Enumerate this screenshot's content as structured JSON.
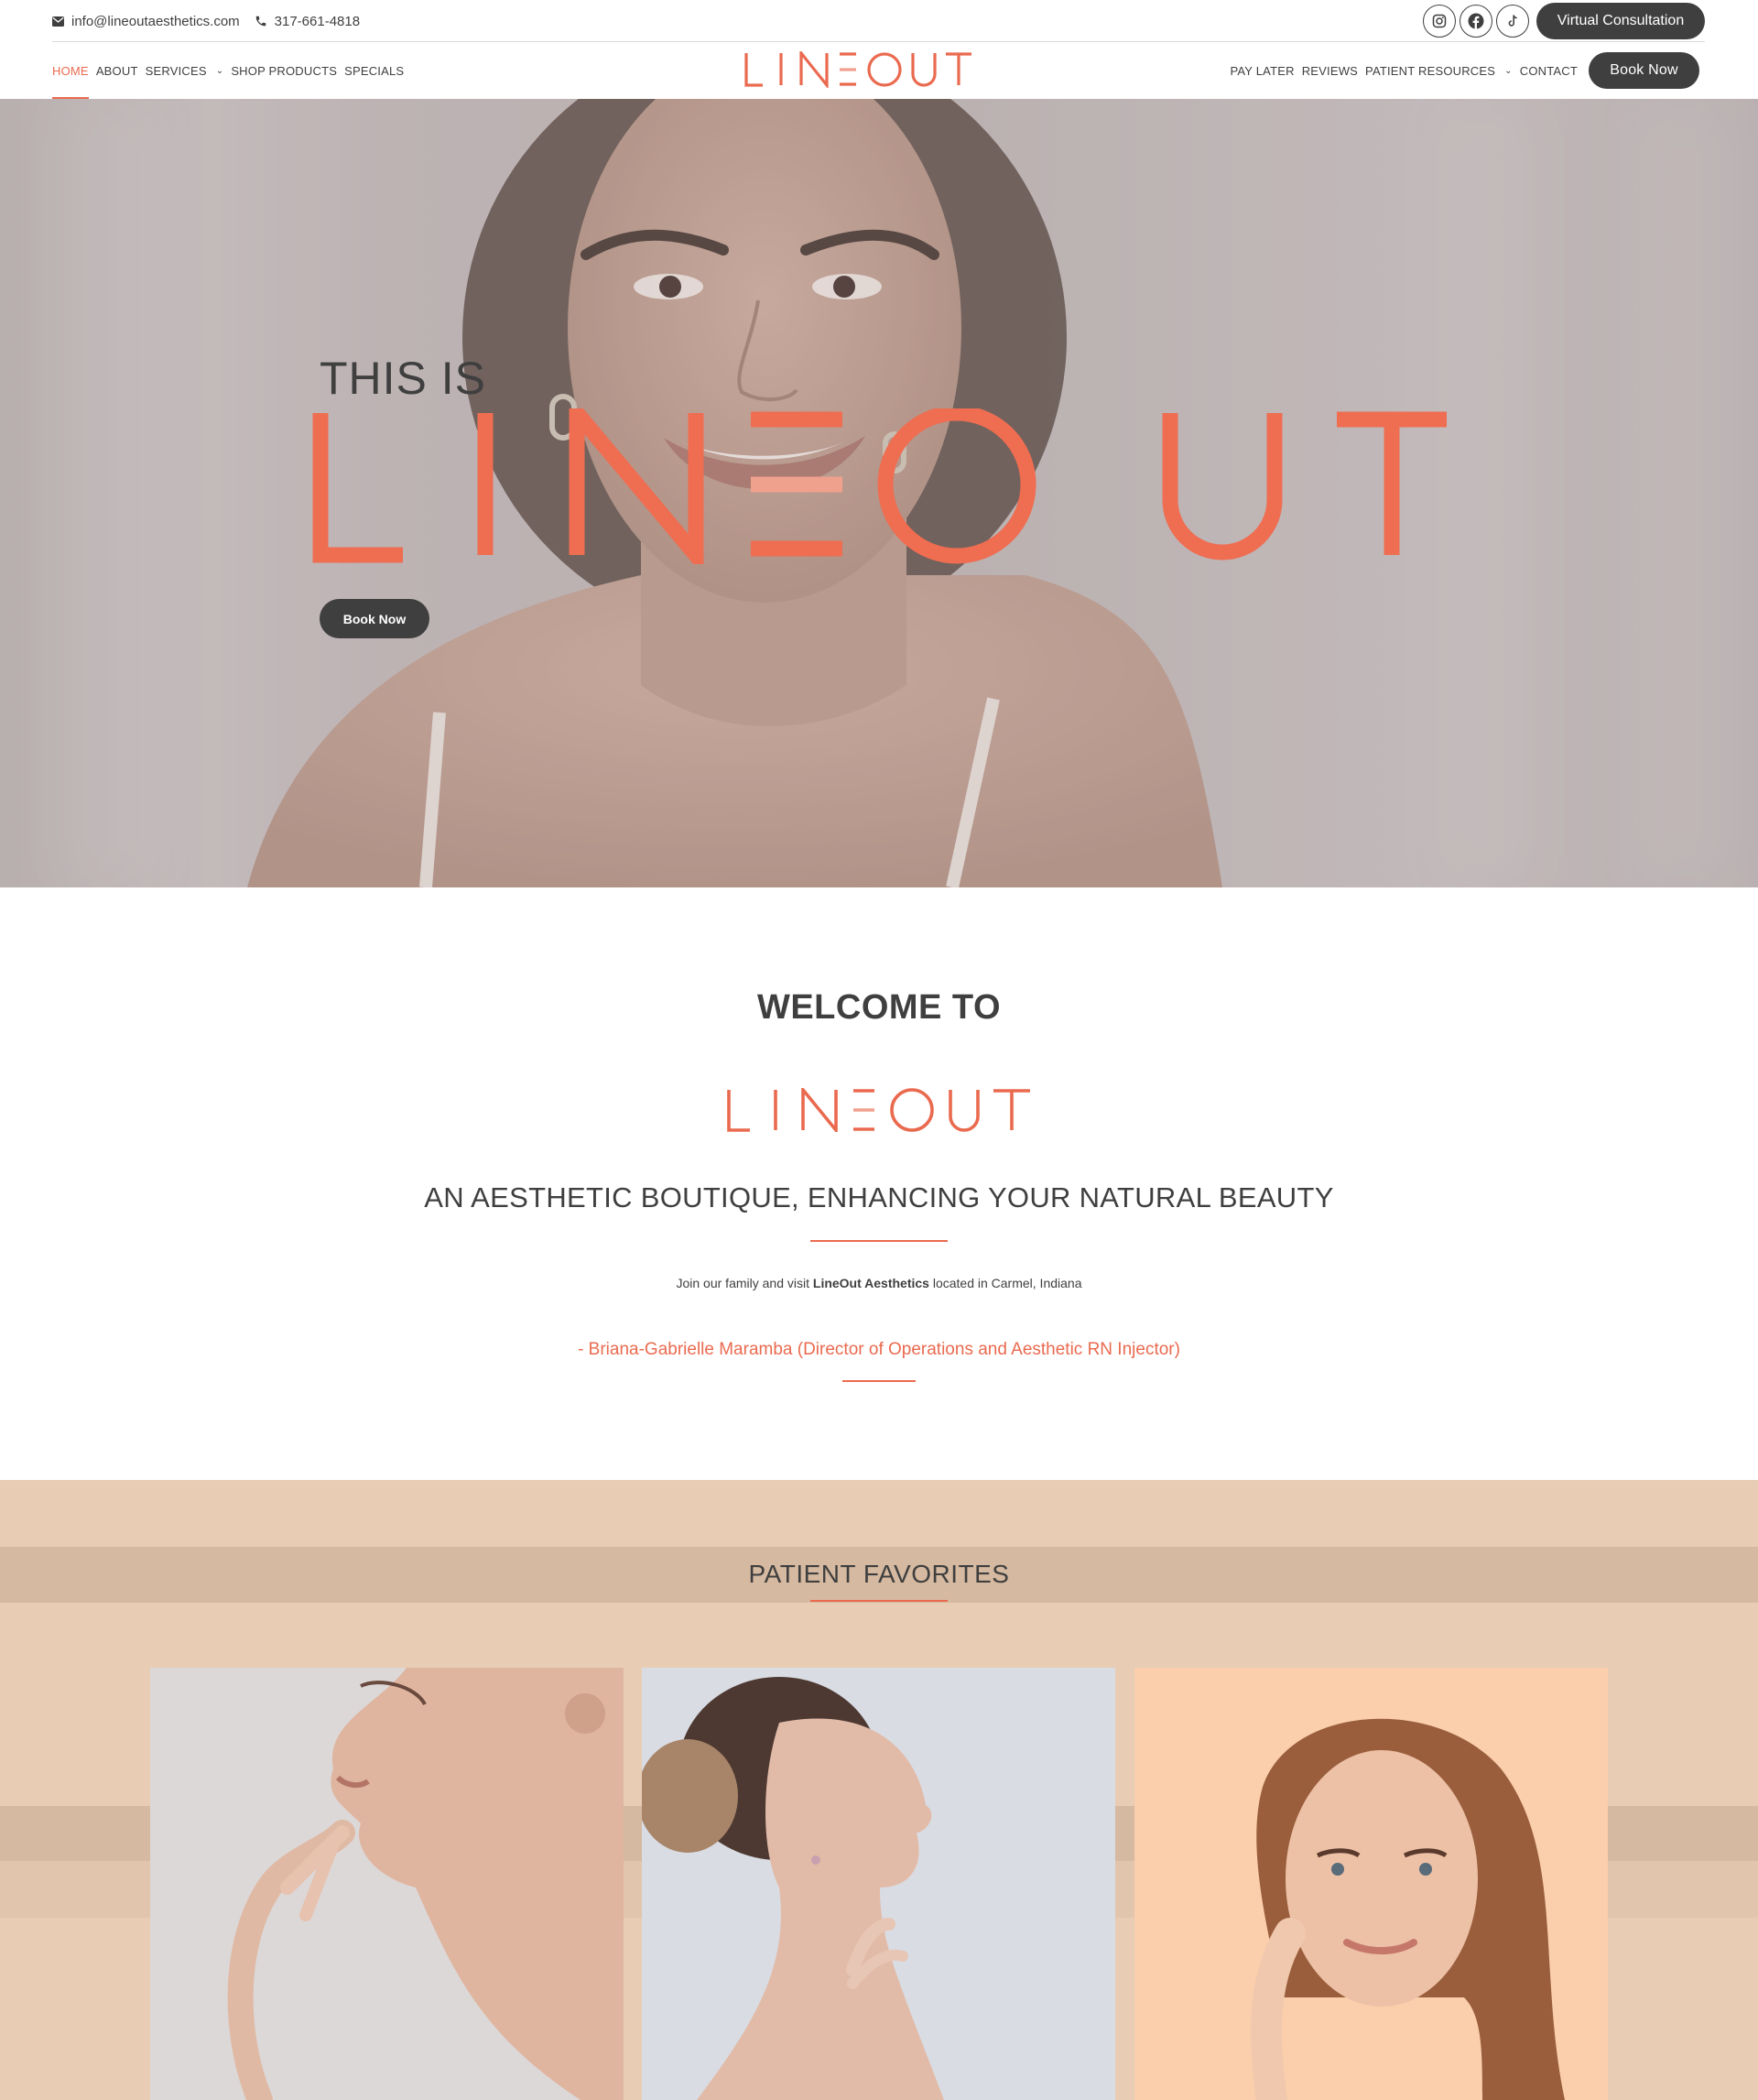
{
  "topbar": {
    "email": "info@lineoutaesthetics.com",
    "phone": "317-661-4818",
    "social": [
      "instagram-icon",
      "facebook-icon",
      "tiktok-icon"
    ],
    "virtual_consultation": "Virtual Consultation"
  },
  "nav": {
    "left": [
      {
        "label": "HOME",
        "active": true
      },
      {
        "label": "ABOUT"
      },
      {
        "label": "SERVICES",
        "dropdown": true
      },
      {
        "label": "SHOP PRODUCTS"
      },
      {
        "label": "SPECIALS"
      }
    ],
    "right": [
      {
        "label": "PAY LATER"
      },
      {
        "label": "REVIEWS"
      },
      {
        "label": "PATIENT RESOURCES",
        "dropdown": true
      },
      {
        "label": "CONTACT"
      }
    ],
    "book_now": "Book Now",
    "logo": "LINEOUT"
  },
  "hero": {
    "eyebrow": "THIS IS",
    "wordmark": "LINEOUT",
    "button": "Book Now"
  },
  "welcome": {
    "title": "WELCOME TO",
    "wordmark": "LINEOUT",
    "tagline": "AN AESTHETIC BOUTIQUE, ENHANCING YOUR NATURAL BEAUTY",
    "intro_prefix": "Join our family and visit ",
    "intro_brand": "LineOut Aesthetics",
    "intro_suffix": " located in Carmel, Indiana",
    "quote": "- Briana-Gabrielle Maramba (Director of Operations and Aesthetic RN Injector)"
  },
  "favorites": {
    "title": "PATIENT FAVORITES"
  },
  "colors": {
    "accent": "#ea6a4f",
    "dark": "#3f3f3f",
    "section_bg": "#e8cdb4"
  }
}
